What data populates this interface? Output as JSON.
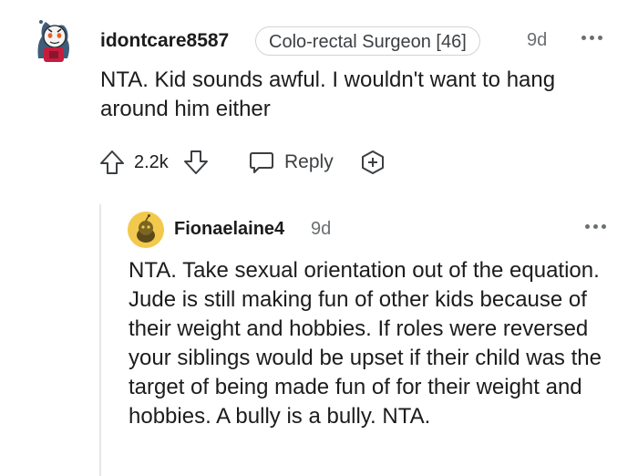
{
  "comment": {
    "username": "idontcare8587",
    "flair": "Colo-rectal Surgeon [46]",
    "time": "9d",
    "body": "NTA. Kid sounds awful. I wouldn't want to hang around him either",
    "score": "2.2k",
    "reply_label": "Reply"
  },
  "reply": {
    "username": "Fionaelaine4",
    "time": "9d",
    "body": "NTA. Take sexual orientation out of the equation. Jude is still making fun of other kids because of their weight and hobbies. If roles were reversed your siblings would be upset if their child was the target of being made fun of for their weight and hobbies. A bully is a bully. NTA."
  },
  "icons": {
    "upvote": "arrow-up-outline-icon",
    "downvote": "arrow-down-outline-icon",
    "reply": "speech-bubble-icon",
    "award": "award-plus-icon",
    "more": "more-options-icon"
  },
  "colors": {
    "text": "#1c1c1c",
    "meta": "#6b6f72",
    "flair_border": "#cfd4d8",
    "thread_line": "#e4e6e8",
    "avatar2_bg": "#f2c94c"
  }
}
